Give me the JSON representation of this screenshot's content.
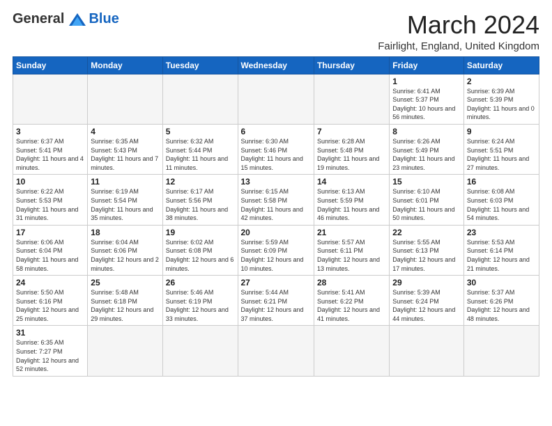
{
  "header": {
    "logo_general": "General",
    "logo_blue": "Blue",
    "month_title": "March 2024",
    "subtitle": "Fairlight, England, United Kingdom"
  },
  "days_of_week": [
    "Sunday",
    "Monday",
    "Tuesday",
    "Wednesday",
    "Thursday",
    "Friday",
    "Saturday"
  ],
  "weeks": [
    [
      {
        "day": "",
        "info": ""
      },
      {
        "day": "",
        "info": ""
      },
      {
        "day": "",
        "info": ""
      },
      {
        "day": "",
        "info": ""
      },
      {
        "day": "",
        "info": ""
      },
      {
        "day": "1",
        "info": "Sunrise: 6:41 AM\nSunset: 5:37 PM\nDaylight: 10 hours and 56 minutes."
      },
      {
        "day": "2",
        "info": "Sunrise: 6:39 AM\nSunset: 5:39 PM\nDaylight: 11 hours and 0 minutes."
      }
    ],
    [
      {
        "day": "3",
        "info": "Sunrise: 6:37 AM\nSunset: 5:41 PM\nDaylight: 11 hours and 4 minutes."
      },
      {
        "day": "4",
        "info": "Sunrise: 6:35 AM\nSunset: 5:43 PM\nDaylight: 11 hours and 7 minutes."
      },
      {
        "day": "5",
        "info": "Sunrise: 6:32 AM\nSunset: 5:44 PM\nDaylight: 11 hours and 11 minutes."
      },
      {
        "day": "6",
        "info": "Sunrise: 6:30 AM\nSunset: 5:46 PM\nDaylight: 11 hours and 15 minutes."
      },
      {
        "day": "7",
        "info": "Sunrise: 6:28 AM\nSunset: 5:48 PM\nDaylight: 11 hours and 19 minutes."
      },
      {
        "day": "8",
        "info": "Sunrise: 6:26 AM\nSunset: 5:49 PM\nDaylight: 11 hours and 23 minutes."
      },
      {
        "day": "9",
        "info": "Sunrise: 6:24 AM\nSunset: 5:51 PM\nDaylight: 11 hours and 27 minutes."
      }
    ],
    [
      {
        "day": "10",
        "info": "Sunrise: 6:22 AM\nSunset: 5:53 PM\nDaylight: 11 hours and 31 minutes."
      },
      {
        "day": "11",
        "info": "Sunrise: 6:19 AM\nSunset: 5:54 PM\nDaylight: 11 hours and 35 minutes."
      },
      {
        "day": "12",
        "info": "Sunrise: 6:17 AM\nSunset: 5:56 PM\nDaylight: 11 hours and 38 minutes."
      },
      {
        "day": "13",
        "info": "Sunrise: 6:15 AM\nSunset: 5:58 PM\nDaylight: 11 hours and 42 minutes."
      },
      {
        "day": "14",
        "info": "Sunrise: 6:13 AM\nSunset: 5:59 PM\nDaylight: 11 hours and 46 minutes."
      },
      {
        "day": "15",
        "info": "Sunrise: 6:10 AM\nSunset: 6:01 PM\nDaylight: 11 hours and 50 minutes."
      },
      {
        "day": "16",
        "info": "Sunrise: 6:08 AM\nSunset: 6:03 PM\nDaylight: 11 hours and 54 minutes."
      }
    ],
    [
      {
        "day": "17",
        "info": "Sunrise: 6:06 AM\nSunset: 6:04 PM\nDaylight: 11 hours and 58 minutes."
      },
      {
        "day": "18",
        "info": "Sunrise: 6:04 AM\nSunset: 6:06 PM\nDaylight: 12 hours and 2 minutes."
      },
      {
        "day": "19",
        "info": "Sunrise: 6:02 AM\nSunset: 6:08 PM\nDaylight: 12 hours and 6 minutes."
      },
      {
        "day": "20",
        "info": "Sunrise: 5:59 AM\nSunset: 6:09 PM\nDaylight: 12 hours and 10 minutes."
      },
      {
        "day": "21",
        "info": "Sunrise: 5:57 AM\nSunset: 6:11 PM\nDaylight: 12 hours and 13 minutes."
      },
      {
        "day": "22",
        "info": "Sunrise: 5:55 AM\nSunset: 6:13 PM\nDaylight: 12 hours and 17 minutes."
      },
      {
        "day": "23",
        "info": "Sunrise: 5:53 AM\nSunset: 6:14 PM\nDaylight: 12 hours and 21 minutes."
      }
    ],
    [
      {
        "day": "24",
        "info": "Sunrise: 5:50 AM\nSunset: 6:16 PM\nDaylight: 12 hours and 25 minutes."
      },
      {
        "day": "25",
        "info": "Sunrise: 5:48 AM\nSunset: 6:18 PM\nDaylight: 12 hours and 29 minutes."
      },
      {
        "day": "26",
        "info": "Sunrise: 5:46 AM\nSunset: 6:19 PM\nDaylight: 12 hours and 33 minutes."
      },
      {
        "day": "27",
        "info": "Sunrise: 5:44 AM\nSunset: 6:21 PM\nDaylight: 12 hours and 37 minutes."
      },
      {
        "day": "28",
        "info": "Sunrise: 5:41 AM\nSunset: 6:22 PM\nDaylight: 12 hours and 41 minutes."
      },
      {
        "day": "29",
        "info": "Sunrise: 5:39 AM\nSunset: 6:24 PM\nDaylight: 12 hours and 44 minutes."
      },
      {
        "day": "30",
        "info": "Sunrise: 5:37 AM\nSunset: 6:26 PM\nDaylight: 12 hours and 48 minutes."
      }
    ],
    [
      {
        "day": "31",
        "info": "Sunrise: 6:35 AM\nSunset: 7:27 PM\nDaylight: 12 hours and 52 minutes."
      },
      {
        "day": "",
        "info": ""
      },
      {
        "day": "",
        "info": ""
      },
      {
        "day": "",
        "info": ""
      },
      {
        "day": "",
        "info": ""
      },
      {
        "day": "",
        "info": ""
      },
      {
        "day": "",
        "info": ""
      }
    ]
  ]
}
